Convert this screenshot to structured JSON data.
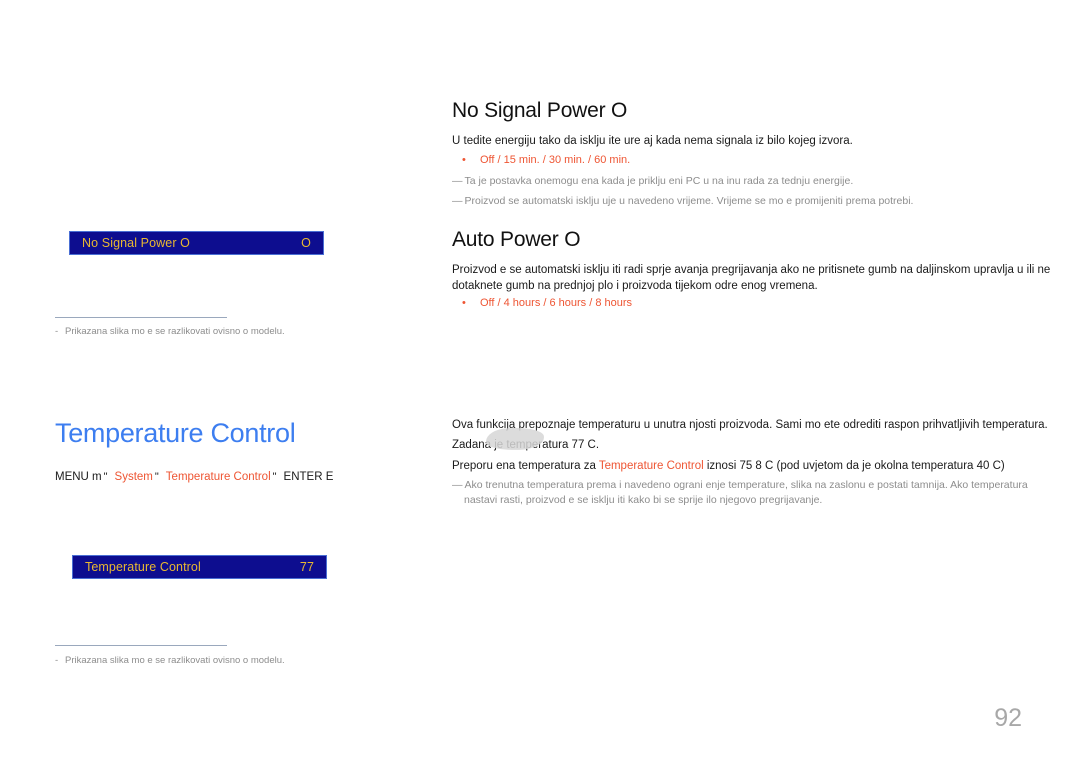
{
  "page": {
    "number": "92",
    "footnote_dash": "-",
    "note_dash": "—"
  },
  "left_panel": {
    "osd_no_signal": {
      "label": "No Signal Power O",
      "value": "O"
    },
    "osd_temperature": {
      "label": "Temperature Control",
      "value": "77"
    },
    "footnote_1": "Prikazana slika mo e se razlikovati ovisno o modelu.",
    "footnote_2": "Prikazana slika mo e se razlikovati ovisno o modelu.",
    "section_title": "Temperature Control",
    "menu_path": {
      "menu_label": "MENU m",
      "arrow_1": "\"",
      "item_system": "System",
      "arrow_2": "\"",
      "item_temperature": "Temperature Control",
      "arrow_3": "\"",
      "enter_label": "ENTER E"
    }
  },
  "right_panel": {
    "no_signal": {
      "heading": "No Signal Power O",
      "paragraph": "U tedite energiju tako da isklju ite ure aj kada nema signala iz bilo kojeg izvora.",
      "bullet": "Off / 15 min. / 30 min. / 60 min.",
      "note_1": "Ta je postavka onemogu ena kada je priklju eni PC u na inu rada za  tednju energije.",
      "note_2": "Proizvod se automatski isklju uje u navedeno vrijeme. Vrijeme se mo e promijeniti prema potrebi."
    },
    "auto_power": {
      "heading": "Auto Power O",
      "paragraph": "Proizvod  e se automatski isklju iti radi sprje avanja pregrijavanja ako ne pritisnete gumb na daljinskom upravlja u ili ne dotaknete gumb na prednjoj plo i proizvoda tijekom odre enog vremena.",
      "bullet": "Off / 4 hours / 6 hours / 8 hours"
    },
    "temperature": {
      "paragraph_1": "Ova funkcija prepoznaje temperaturu u unutra njosti proizvoda. Sami mo ete odrediti raspon prihvatljivih temperatura.",
      "paragraph_2_prefix": "Zadana je temperatura ",
      "paragraph_2_value": "77 C.",
      "paragraph_3_prefix": "Preporu ena temperatura za ",
      "paragraph_3_accent": "Temperature Control",
      "paragraph_3_mid": " iznosi 75 8 C (pod uvjetom da je okolna temperatura 40 C)",
      "note_1_line_1": "Ako trenutna temperatura prema i navedeno ograni enje temperature, slika na zaslonu  e postati tamnija. Ako temperatura",
      "note_1_line_2": "nastavi rasti, proizvod  e se isklju iti kako bi se sprije ilo njegovo pregrijavanje."
    }
  },
  "colors": {
    "accent_orange": "#ee5533",
    "heading_blue": "#3d7ef0",
    "osd_background": "#0d0d8f",
    "osd_text": "#e8b832",
    "note_gray": "#8d8d8d",
    "page_number_gray": "#a8a8a8"
  }
}
